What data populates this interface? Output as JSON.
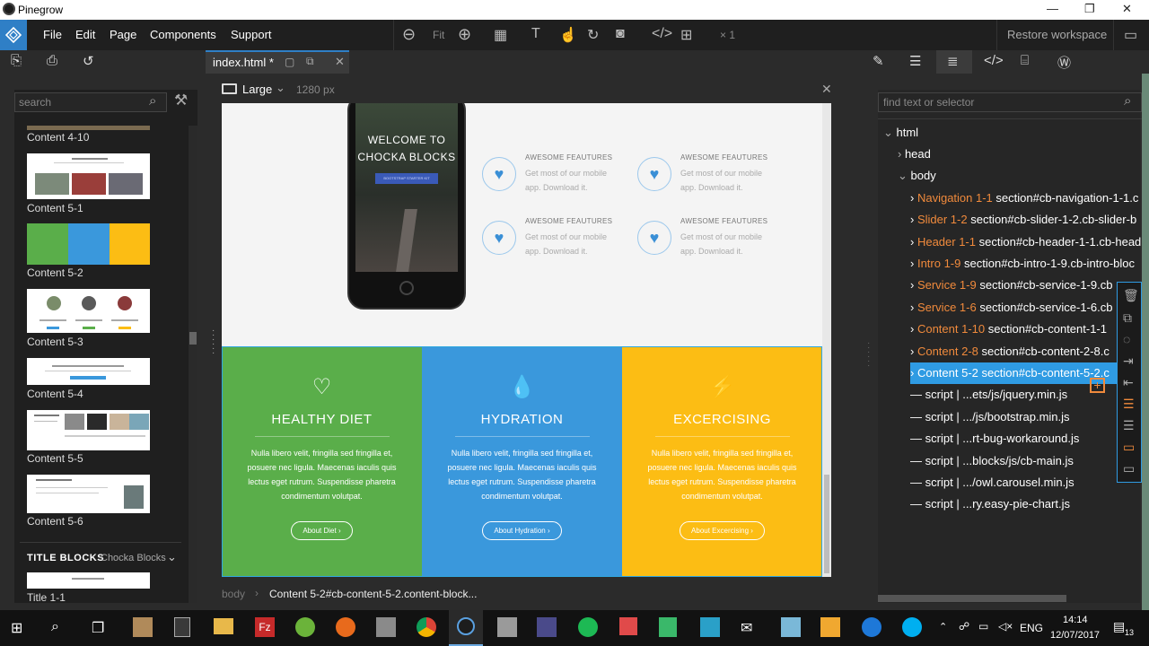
{
  "window": {
    "title": "Pinegrow",
    "controls": [
      "—",
      "❐",
      "✕"
    ]
  },
  "menu": [
    "File",
    "Edit",
    "Page",
    "Components",
    "Support"
  ],
  "toolbar": {
    "fit": "Fit",
    "zoom_count": "× 1",
    "restore": "Restore workspace"
  },
  "tab": {
    "label": "index.html *"
  },
  "left": {
    "search_placeholder": "search",
    "items": [
      "Content 4-10",
      "Content 5-1",
      "Content 5-2",
      "Content 5-3",
      "Content 5-4",
      "Content 5-5",
      "Content 5-6"
    ],
    "section_title": "TITLE BLOCKS",
    "section_sub": "Chocka Blocks",
    "last_item": "Title 1-1"
  },
  "canvas": {
    "device": "Large",
    "width": "1280 px",
    "hero_line1": "WELCOME TO",
    "hero_line2": "CHOCKA BLOCKS",
    "hero_button": "BOOTSTRAP STARTER KIT",
    "features": [
      {
        "title": "AWESOME FEAUTURES",
        "desc": "Get most of our mobile app. Download it."
      },
      {
        "title": "AWESOME FEAUTURES",
        "desc": "Get most of our mobile app. Download it."
      },
      {
        "title": "AWESOME FEAUTURES",
        "desc": "Get most of our mobile app. Download it."
      },
      {
        "title": "AWESOME FEAUTURES",
        "desc": "Get most of our mobile app. Download it."
      }
    ],
    "columns": [
      {
        "heading": "HEALTHY DIET",
        "text": "Nulla libero velit, fringilla sed fringilla et, posuere nec ligula. Maecenas iaculis quis lectus eget rutrum. Suspendisse pharetra condimentum volutpat.",
        "button": "About Diet  ›",
        "color": "#5aae4a"
      },
      {
        "heading": "HYDRATION",
        "text": "Nulla libero velit, fringilla sed fringilla et, posuere nec ligula. Maecenas iaculis quis lectus eget rutrum. Suspendisse pharetra condimentum volutpat.",
        "button": "About Hydration  ›",
        "color": "#3a98dc"
      },
      {
        "heading": "EXCERCISING",
        "text": "Nulla libero velit, fringilla sed fringilla et, posuere nec ligula. Maecenas iaculis quis lectus eget rutrum. Suspendisse pharetra condimentum volutpat.",
        "button": "About Excercising  ›",
        "color": "#fcbd14"
      }
    ]
  },
  "breadcrumb": {
    "root": "body",
    "current": "Content 5-2#cb-content-5-2.content-block..."
  },
  "right": {
    "search_placeholder": "find text or selector",
    "tree": [
      {
        "name": "html",
        "sel": ""
      },
      {
        "name": "head",
        "sel": ""
      },
      {
        "name": "body",
        "sel": ""
      },
      {
        "name": "Navigation 1-1",
        "sel": "section#cb-navigation-1-1.c"
      },
      {
        "name": "Slider 1-2",
        "sel": "section#cb-slider-1-2.cb-slider-b"
      },
      {
        "name": "Header 1-1",
        "sel": "section#cb-header-1-1.cb-head"
      },
      {
        "name": "Intro 1-9",
        "sel": "section#cb-intro-1-9.cb-intro-bloc"
      },
      {
        "name": "Service 1-9",
        "sel": "section#cb-service-1-9.cb"
      },
      {
        "name": "Service 1-6",
        "sel": "section#cb-service-1-6.cb"
      },
      {
        "name": "Content 1-10",
        "sel": "section#cb-content-1-1"
      },
      {
        "name": "Content 2-8",
        "sel": "section#cb-content-2-8.c"
      },
      {
        "name": "Content 5-2",
        "sel": "section#cb-content-5-2.c"
      },
      {
        "name": "script",
        "sel": "| ...ets/js/jquery.min.js"
      },
      {
        "name": "script",
        "sel": "| .../js/bootstrap.min.js"
      },
      {
        "name": "script",
        "sel": "| ...rt-bug-workaround.js"
      },
      {
        "name": "script",
        "sel": "| ...blocks/js/cb-main.js"
      },
      {
        "name": "script",
        "sel": "| .../owl.carousel.min.js"
      },
      {
        "name": "script",
        "sel": "| ...ry.easy-pie-chart.js"
      }
    ]
  },
  "taskbar": {
    "lang": "ENG",
    "time": "14:14",
    "date": "12/07/2017",
    "notif": "13"
  }
}
